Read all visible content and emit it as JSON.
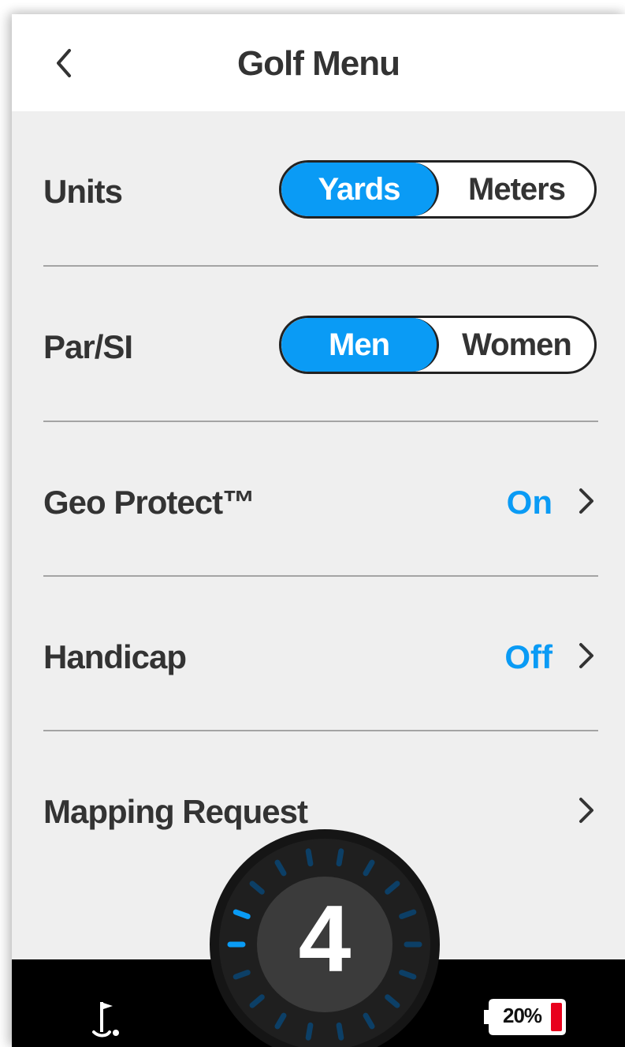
{
  "header": {
    "title": "Golf Menu",
    "back_icon": "chevron-left-icon"
  },
  "settings": {
    "units": {
      "label": "Units",
      "options": [
        "Yards",
        "Meters"
      ],
      "selected": "Yards"
    },
    "par_si": {
      "label": "Par/SI",
      "options": [
        "Men",
        "Women"
      ],
      "selected": "Men"
    },
    "geo_protect": {
      "label": "Geo Protect™",
      "value": "On"
    },
    "handicap": {
      "label": "Handicap",
      "value": "Off"
    },
    "mapping_request": {
      "label": "Mapping Request"
    }
  },
  "bottom_bar": {
    "hole_number": "4",
    "battery_text": "20%",
    "battery_level": 0.2,
    "flag_icon": "golf-flag-icon",
    "battery_icon": "battery-icon"
  },
  "colors": {
    "accent": "#0a9bf5",
    "text": "#333333",
    "background": "#efefef",
    "bar": "#000000",
    "battery_low": "#e8001c"
  }
}
